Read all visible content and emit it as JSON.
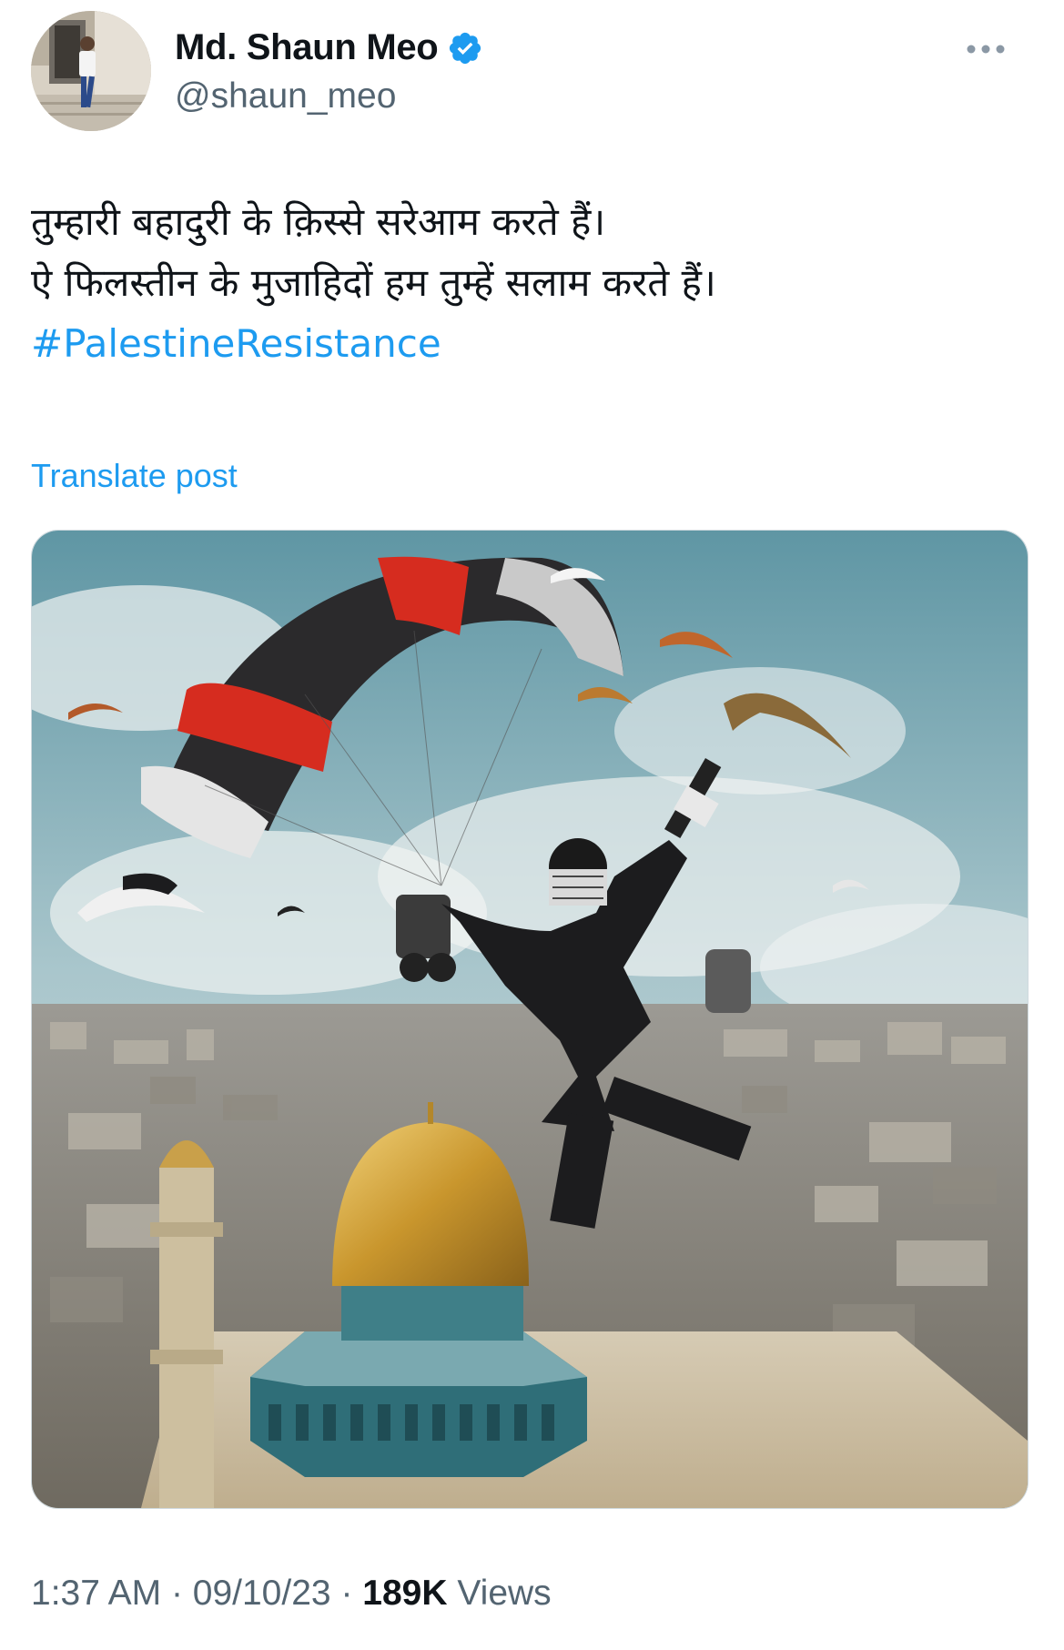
{
  "author": {
    "display_name": "Md. Shaun Meo",
    "handle": "@shaun_meo",
    "verified_icon": "verified-badge-icon",
    "avatar_alt": "profile photo"
  },
  "more_icon": "more-horizontal-icon",
  "tweet": {
    "lines": [
      "तुम्हारी बहादुरी के क़िस्से सरेआम करते हैं।",
      "ऐ फिलस्तीन के मुजाहिदों हम तुम्हें सलाम करते हैं।"
    ],
    "hashtag": "#PalestineResistance"
  },
  "translate_label": "Translate post",
  "media": {
    "alt": "Image of paragliders over a city with a golden dome"
  },
  "meta": {
    "time": "1:37 AM",
    "separator": "·",
    "date": "09/10/23",
    "views_count": "189K",
    "views_label": "Views"
  },
  "colors": {
    "accent": "#1d9bf0",
    "text": "#0f1419",
    "secondary": "#536471"
  }
}
